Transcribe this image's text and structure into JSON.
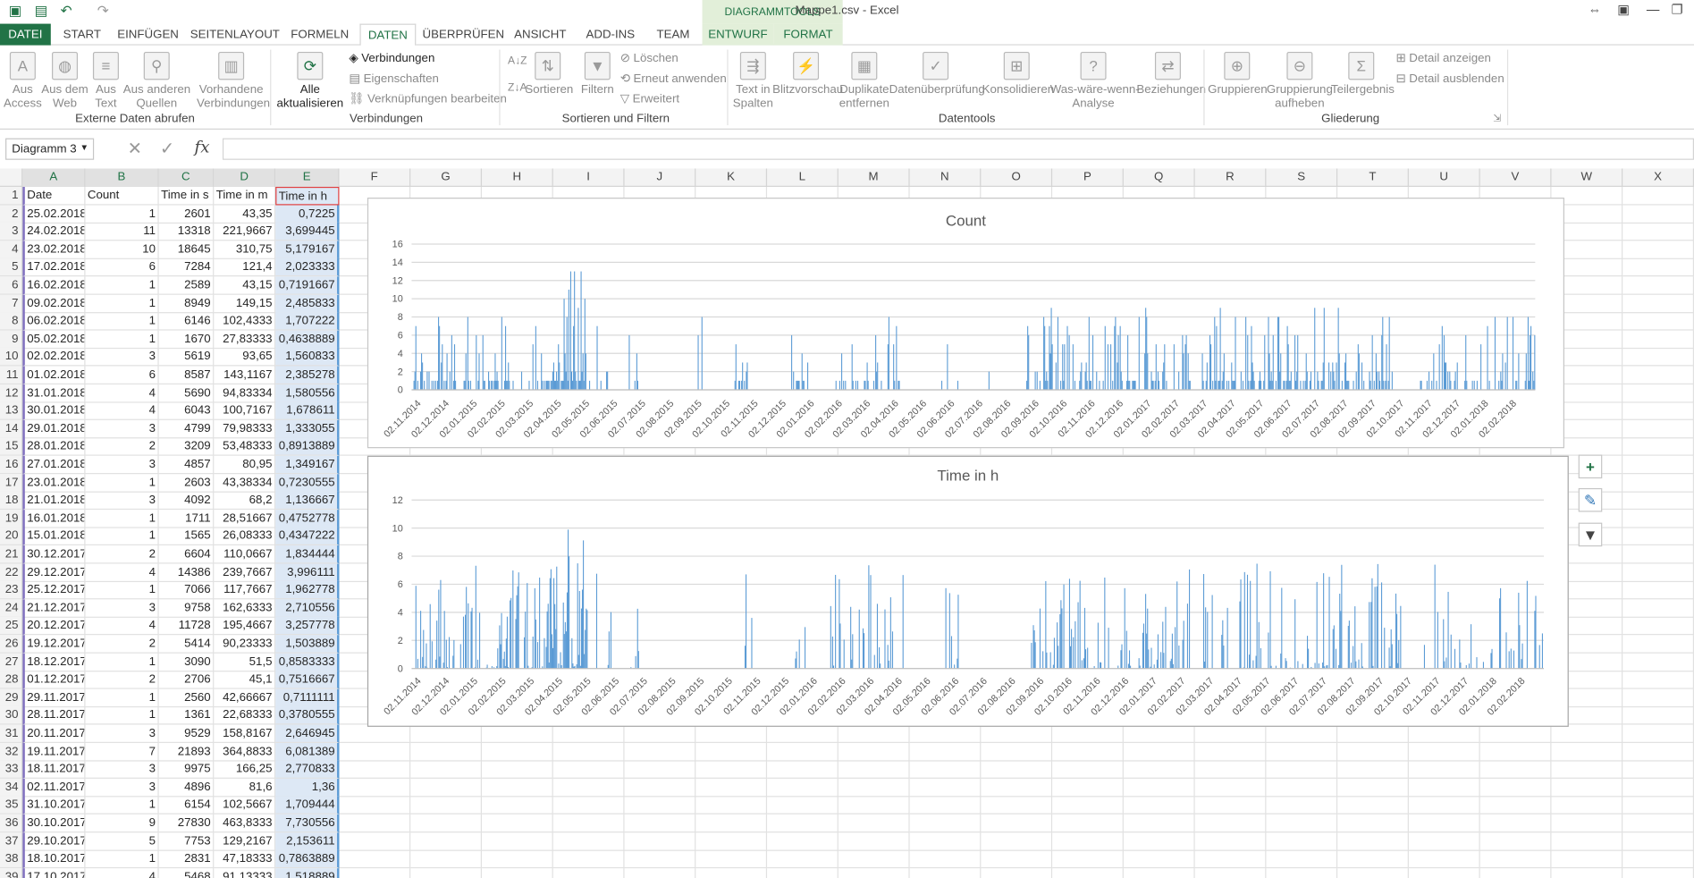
{
  "window": {
    "title": "Mappe1.csv - Excel",
    "context_tab_group": "DIAGRAMMTOOLS"
  },
  "tabs": [
    "DATEI",
    "START",
    "EINFÜGEN",
    "SEITENLAYOUT",
    "FORMELN",
    "DATEN",
    "ÜBERPRÜFEN",
    "ANSICHT",
    "ADD-INS",
    "TEAM",
    "ENTWURF",
    "FORMAT"
  ],
  "ribbon": {
    "external": {
      "access": "Aus\nAccess",
      "web": "Aus dem\nWeb",
      "text": "Aus\nText",
      "other": "Aus anderen\nQuellen",
      "existing": "Vorhandene\nVerbindungen",
      "group": "Externe Daten abrufen"
    },
    "connections": {
      "refresh_all": "Alle\naktualisieren",
      "connections": "Verbindungen",
      "properties": "Eigenschaften",
      "edit_links": "Verknüpfungen bearbeiten",
      "group": "Verbindungen"
    },
    "sort": {
      "sort": "Sortieren",
      "filter": "Filtern",
      "clear": "Löschen",
      "reapply": "Erneut anwenden",
      "advanced": "Erweitert",
      "group": "Sortieren und Filtern"
    },
    "tools": {
      "text_to_columns": "Text in\nSpalten",
      "flash_fill": "Blitzvorschau",
      "remove_dup": "Duplikate\nentfernen",
      "validation": "Datenüberprüfung",
      "consolidate": "Konsolidieren",
      "whatif": "Was-wäre-wenn-\nAnalyse",
      "relations": "Beziehungen",
      "group": "Datentools"
    },
    "outline": {
      "group_btn": "Gruppieren",
      "ungroup": "Gruppierung\naufheben",
      "subtotal": "Teilergebnis",
      "show_detail": "Detail anzeigen",
      "hide_detail": "Detail ausblenden",
      "group": "Gliederung"
    }
  },
  "namebox": "Diagramm 3",
  "formula_glyph": "fx",
  "columns": [
    "A",
    "B",
    "C",
    "D",
    "E",
    "F",
    "G",
    "H",
    "I",
    "J",
    "K",
    "L",
    "M",
    "N",
    "O",
    "P",
    "Q",
    "R",
    "S",
    "T",
    "U",
    "V",
    "W",
    "X"
  ],
  "headers": [
    "Date",
    "Count",
    "Time in s",
    "Time in m",
    "Time in h"
  ],
  "rows": [
    [
      "25.02.2018",
      "1",
      "2601",
      "43,35",
      "0,7225"
    ],
    [
      "24.02.2018",
      "11",
      "13318",
      "221,9667",
      "3,699445"
    ],
    [
      "23.02.2018",
      "10",
      "18645",
      "310,75",
      "5,179167"
    ],
    [
      "17.02.2018",
      "6",
      "7284",
      "121,4",
      "2,023333"
    ],
    [
      "16.02.2018",
      "1",
      "2589",
      "43,15",
      "0,7191667"
    ],
    [
      "09.02.2018",
      "1",
      "8949",
      "149,15",
      "2,485833"
    ],
    [
      "06.02.2018",
      "1",
      "6146",
      "102,4333",
      "1,707222"
    ],
    [
      "05.02.2018",
      "1",
      "1670",
      "27,83333",
      "0,4638889"
    ],
    [
      "02.02.2018",
      "3",
      "5619",
      "93,65",
      "1,560833"
    ],
    [
      "01.02.2018",
      "6",
      "8587",
      "143,1167",
      "2,385278"
    ],
    [
      "31.01.2018",
      "4",
      "5690",
      "94,83334",
      "1,580556"
    ],
    [
      "30.01.2018",
      "4",
      "6043",
      "100,7167",
      "1,678611"
    ],
    [
      "29.01.2018",
      "3",
      "4799",
      "79,98333",
      "1,333055"
    ],
    [
      "28.01.2018",
      "2",
      "3209",
      "53,48333",
      "0,8913889"
    ],
    [
      "27.01.2018",
      "3",
      "4857",
      "80,95",
      "1,349167"
    ],
    [
      "23.01.2018",
      "1",
      "2603",
      "43,38334",
      "0,7230555"
    ],
    [
      "21.01.2018",
      "3",
      "4092",
      "68,2",
      "1,136667"
    ],
    [
      "16.01.2018",
      "1",
      "1711",
      "28,51667",
      "0,4752778"
    ],
    [
      "15.01.2018",
      "1",
      "1565",
      "26,08333",
      "0,4347222"
    ],
    [
      "30.12.2017",
      "2",
      "6604",
      "110,0667",
      "1,834444"
    ],
    [
      "29.12.2017",
      "4",
      "14386",
      "239,7667",
      "3,996111"
    ],
    [
      "25.12.2017",
      "1",
      "7066",
      "117,7667",
      "1,962778"
    ],
    [
      "21.12.2017",
      "3",
      "9758",
      "162,6333",
      "2,710556"
    ],
    [
      "20.12.2017",
      "4",
      "11728",
      "195,4667",
      "3,257778"
    ],
    [
      "19.12.2017",
      "2",
      "5414",
      "90,23333",
      "1,503889"
    ],
    [
      "18.12.2017",
      "1",
      "3090",
      "51,5",
      "0,8583333"
    ],
    [
      "01.12.2017",
      "2",
      "2706",
      "45,1",
      "0,7516667"
    ],
    [
      "29.11.2017",
      "1",
      "2560",
      "42,66667",
      "0,7111111"
    ],
    [
      "28.11.2017",
      "1",
      "1361",
      "22,68333",
      "0,3780555"
    ],
    [
      "20.11.2017",
      "3",
      "9529",
      "158,8167",
      "2,646945"
    ],
    [
      "19.11.2017",
      "7",
      "21893",
      "364,8833",
      "6,081389"
    ],
    [
      "18.11.2017",
      "3",
      "9975",
      "166,25",
      "2,770833"
    ],
    [
      "02.11.2017",
      "3",
      "4896",
      "81,6",
      "1,36"
    ],
    [
      "31.10.2017",
      "1",
      "6154",
      "102,5667",
      "1,709444"
    ],
    [
      "30.10.2017",
      "9",
      "27830",
      "463,8333",
      "7,730556"
    ],
    [
      "29.10.2017",
      "5",
      "7753",
      "129,2167",
      "2,153611"
    ],
    [
      "18.10.2017",
      "1",
      "2831",
      "47,18333",
      "0,7863889"
    ],
    [
      "17.10.2017",
      "4",
      "5468",
      "91,13333",
      "1,518889"
    ]
  ],
  "chart_data": [
    {
      "type": "bar",
      "title": "Count",
      "ylim": [
        0,
        16
      ],
      "yticks": [
        0,
        2,
        4,
        6,
        8,
        10,
        12,
        14,
        16
      ],
      "categories": [
        "02.11.2014",
        "02.12.2014",
        "02.01.2015",
        "02.02.2015",
        "02.03.2015",
        "02.04.2015",
        "02.05.2015",
        "02.06.2015",
        "02.07.2015",
        "02.08.2015",
        "02.09.2015",
        "02.10.2015",
        "02.11.2015",
        "02.12.2015",
        "02.01.2016",
        "02.02.2016",
        "02.03.2016",
        "02.04.2016",
        "02.05.2016",
        "02.06.2016",
        "02.07.2016",
        "02.08.2016",
        "02.09.2016",
        "02.10.2016",
        "02.11.2016",
        "02.12.2016",
        "02.01.2017",
        "02.02.2017",
        "02.03.2017",
        "02.04.2017",
        "02.05.2017",
        "02.06.2017",
        "02.07.2017",
        "02.08.2017",
        "02.09.2017",
        "02.10.2017",
        "02.11.2017",
        "02.12.2017",
        "02.01.2018",
        "02.02.2018"
      ],
      "color": "#5b9bd5",
      "grid": true,
      "legend": "none"
    },
    {
      "type": "bar",
      "title": "Time in h",
      "ylim": [
        0,
        12
      ],
      "yticks": [
        0,
        2,
        4,
        6,
        8,
        10,
        12
      ],
      "categories": [
        "02.11.2014",
        "02.12.2014",
        "02.01.2015",
        "02.02.2015",
        "02.03.2015",
        "02.04.2015",
        "02.05.2015",
        "02.06.2015",
        "02.07.2015",
        "02.08.2015",
        "02.09.2015",
        "02.10.2015",
        "02.11.2015",
        "02.12.2015",
        "02.01.2016",
        "02.02.2016",
        "02.03.2016",
        "02.04.2016",
        "02.05.2016",
        "02.06.2016",
        "02.07.2016",
        "02.08.2016",
        "02.09.2016",
        "02.10.2016",
        "02.11.2016",
        "02.12.2016",
        "02.01.2017",
        "02.02.2017",
        "02.03.2017",
        "02.04.2017",
        "02.05.2017",
        "02.06.2017",
        "02.07.2017",
        "02.08.2017",
        "02.09.2017",
        "02.10.2017",
        "02.11.2017",
        "02.12.2017",
        "02.01.2018",
        "02.02.2018"
      ],
      "color": "#5b9bd5",
      "grid": true,
      "legend": "none"
    }
  ],
  "colors": {
    "accent": "#217346",
    "series": "#5b9bd5",
    "selection": "#7f6fbf"
  }
}
